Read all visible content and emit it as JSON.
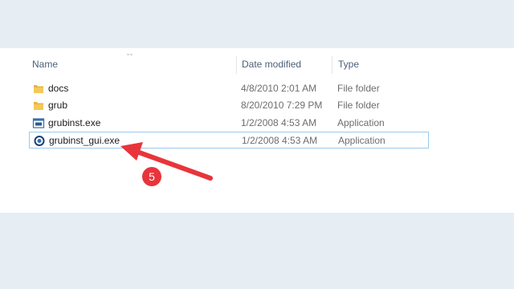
{
  "header": {
    "name": "Name",
    "date_modified": "Date modified",
    "type": "Type",
    "sort_indicator": "^"
  },
  "files": [
    {
      "name": "docs",
      "date": "4/8/2010 2:01 AM",
      "type": "File folder",
      "icon": "folder-icon"
    },
    {
      "name": "grub",
      "date": "8/20/2010 7:29 PM",
      "type": "File folder",
      "icon": "folder-icon"
    },
    {
      "name": "grubinst.exe",
      "date": "1/2/2008 4:53 AM",
      "type": "Application",
      "icon": "exe-window-icon"
    },
    {
      "name": "grubinst_gui.exe",
      "date": "1/2/2008 4:53 AM",
      "type": "Application",
      "icon": "exe-gui-icon",
      "selected": true
    }
  ],
  "annotation": {
    "step_number": "5",
    "color": "#e8353b"
  },
  "colors": {
    "folder": "#e8b53c",
    "selection_border": "#99c9ef",
    "header_text": "#4c607a",
    "background": "#e6edf3"
  }
}
